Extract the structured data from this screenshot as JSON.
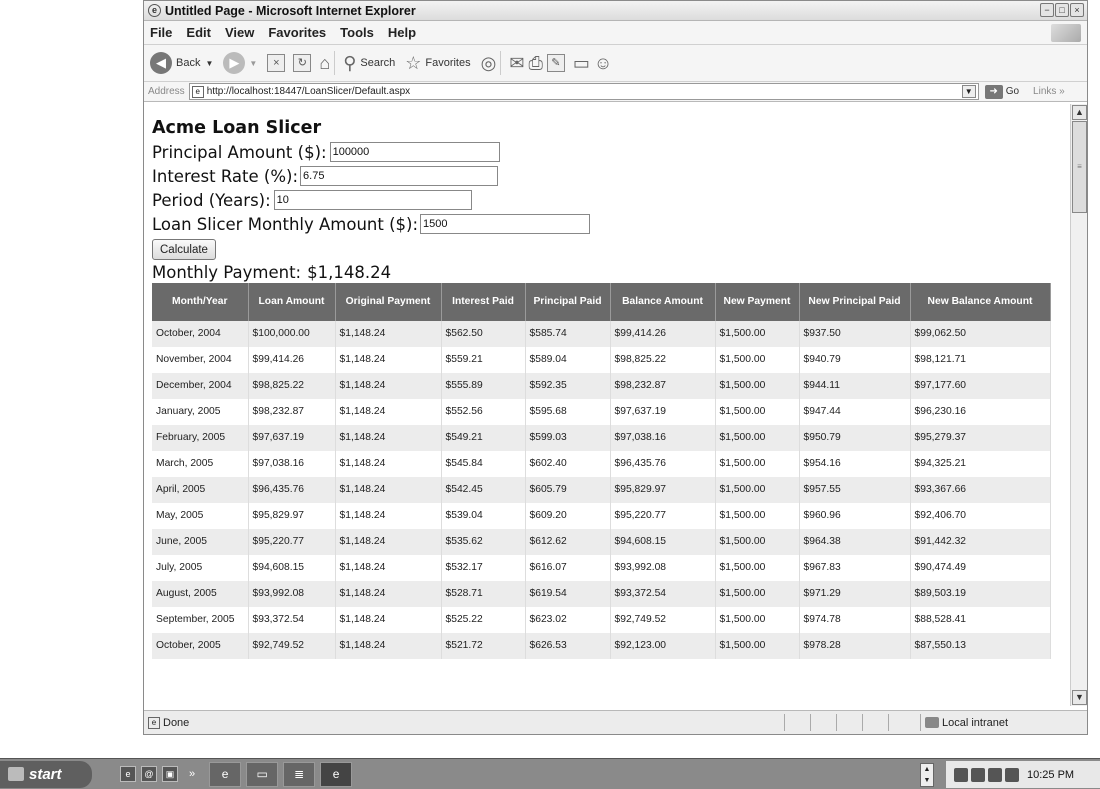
{
  "window": {
    "title": "Untitled Page - Microsoft Internet Explorer",
    "controls": [
      "−",
      "□",
      "×"
    ]
  },
  "menu": [
    "File",
    "Edit",
    "View",
    "Favorites",
    "Tools",
    "Help"
  ],
  "toolbar": {
    "back": "Back",
    "search": "Search",
    "favorites": "Favorites"
  },
  "address": {
    "label": "Address",
    "url": "http://localhost:18447/LoanSlicer/Default.aspx",
    "go": "Go",
    "links": "Links"
  },
  "page": {
    "title": "Acme Loan Slicer",
    "fields": [
      {
        "label": "Principal Amount ($):",
        "value": "100000",
        "width": 170
      },
      {
        "label": "Interest Rate (%):",
        "value": "6.75",
        "width": 198
      },
      {
        "label": "Period (Years):",
        "value": "10",
        "width": 198
      },
      {
        "label": "Loan Slicer Monthly Amount ($):",
        "value": "1500",
        "width": 170
      }
    ],
    "calculate": "Calculate",
    "monthly_label": "Monthly Payment:",
    "monthly_value": "$1,148.24",
    "table": {
      "headers": [
        "Month/Year",
        "Loan Amount",
        "Original Payment",
        "Interest Paid",
        "Principal Paid",
        "Balance Amount",
        "New Payment",
        "New Principal Paid",
        "New Balance Amount"
      ],
      "rows": [
        [
          "October, 2004",
          "$100,000.00",
          "$1,148.24",
          "$562.50",
          "$585.74",
          "$99,414.26",
          "$1,500.00",
          "$937.50",
          "$99,062.50"
        ],
        [
          "November, 2004",
          "$99,414.26",
          "$1,148.24",
          "$559.21",
          "$589.04",
          "$98,825.22",
          "$1,500.00",
          "$940.79",
          "$98,121.71"
        ],
        [
          "December, 2004",
          "$98,825.22",
          "$1,148.24",
          "$555.89",
          "$592.35",
          "$98,232.87",
          "$1,500.00",
          "$944.11",
          "$97,177.60"
        ],
        [
          "January, 2005",
          "$98,232.87",
          "$1,148.24",
          "$552.56",
          "$595.68",
          "$97,637.19",
          "$1,500.00",
          "$947.44",
          "$96,230.16"
        ],
        [
          "February, 2005",
          "$97,637.19",
          "$1,148.24",
          "$549.21",
          "$599.03",
          "$97,038.16",
          "$1,500.00",
          "$950.79",
          "$95,279.37"
        ],
        [
          "March, 2005",
          "$97,038.16",
          "$1,148.24",
          "$545.84",
          "$602.40",
          "$96,435.76",
          "$1,500.00",
          "$954.16",
          "$94,325.21"
        ],
        [
          "April, 2005",
          "$96,435.76",
          "$1,148.24",
          "$542.45",
          "$605.79",
          "$95,829.97",
          "$1,500.00",
          "$957.55",
          "$93,367.66"
        ],
        [
          "May, 2005",
          "$95,829.97",
          "$1,148.24",
          "$539.04",
          "$609.20",
          "$95,220.77",
          "$1,500.00",
          "$960.96",
          "$92,406.70"
        ],
        [
          "June, 2005",
          "$95,220.77",
          "$1,148.24",
          "$535.62",
          "$612.62",
          "$94,608.15",
          "$1,500.00",
          "$964.38",
          "$91,442.32"
        ],
        [
          "July, 2005",
          "$94,608.15",
          "$1,148.24",
          "$532.17",
          "$616.07",
          "$93,992.08",
          "$1,500.00",
          "$967.83",
          "$90,474.49"
        ],
        [
          "August, 2005",
          "$93,992.08",
          "$1,148.24",
          "$528.71",
          "$619.54",
          "$93,372.54",
          "$1,500.00",
          "$971.29",
          "$89,503.19"
        ],
        [
          "September, 2005",
          "$93,372.54",
          "$1,148.24",
          "$525.22",
          "$623.02",
          "$92,749.52",
          "$1,500.00",
          "$974.78",
          "$88,528.41"
        ],
        [
          "October, 2005",
          "$92,749.52",
          "$1,148.24",
          "$521.72",
          "$626.53",
          "$92,123.00",
          "$1,500.00",
          "$978.28",
          "$87,550.13"
        ]
      ]
    }
  },
  "status": {
    "text": "Done",
    "zone": "Local intranet"
  },
  "taskbar": {
    "start": "start",
    "more": "»",
    "clock": "10:25 PM"
  }
}
